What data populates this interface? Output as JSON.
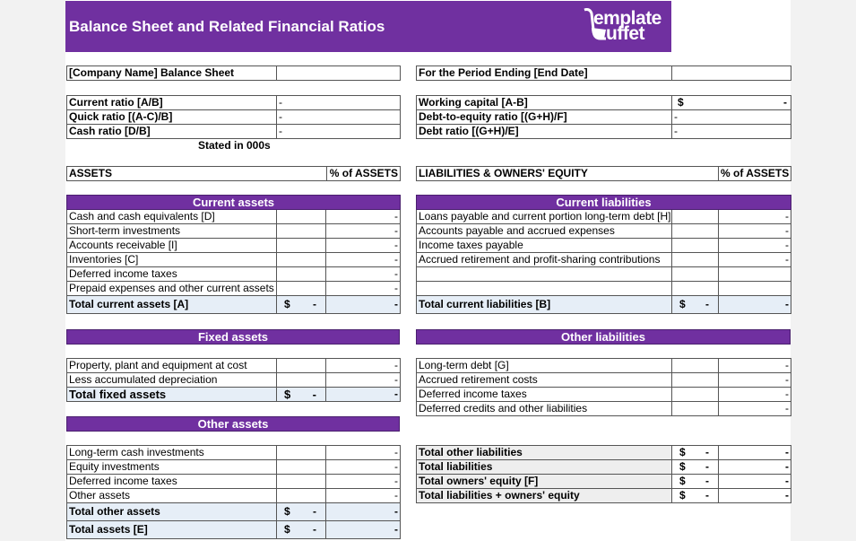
{
  "title": "Balance Sheet and Related Financial Ratios",
  "logo": {
    "line1": "emplate",
    "line2": "uffet",
    "icon": "ladle-icon"
  },
  "colors": {
    "accent": "#7030a0",
    "total_fill": "#e6eef7"
  },
  "header": {
    "company": "[Company Name] Balance Sheet",
    "company_value": "",
    "period": "For the Period Ending [End Date]",
    "period_value": ""
  },
  "ratios_left": [
    {
      "label": "Current ratio  [A/B]",
      "value": "-"
    },
    {
      "label": "Quick ratio  [(A-C)/B]",
      "value": "-"
    },
    {
      "label": "Cash ratio  [D/B]",
      "value": "-"
    }
  ],
  "ratios_right": [
    {
      "label": "Working capital  [A-B]",
      "currency": "$",
      "value": "-"
    },
    {
      "label": "Debt-to-equity ratio  [(G+H)/F]",
      "value": "-"
    },
    {
      "label": "Debt ratio  [(G+H)/E]",
      "value": "-"
    }
  ],
  "stated_note": "Stated in 000s",
  "assets": {
    "heading": "ASSETS",
    "pct_heading": "% of ASSETS",
    "current": {
      "title": "Current assets",
      "rows": [
        {
          "label": "Cash and cash equivalents  [D]",
          "amount": "",
          "pct": "-"
        },
        {
          "label": "Short-term investments",
          "amount": "",
          "pct": "-"
        },
        {
          "label": "Accounts receivable  [I]",
          "amount": "",
          "pct": "-"
        },
        {
          "label": "Inventories  [C]",
          "amount": "",
          "pct": "-"
        },
        {
          "label": "Deferred income taxes",
          "amount": "",
          "pct": "-"
        },
        {
          "label": "Prepaid expenses and other current assets",
          "amount": "",
          "pct": "-"
        }
      ],
      "total": {
        "label": "Total current assets  [A]",
        "currency": "$",
        "amount": "-",
        "pct": "-"
      }
    },
    "fixed": {
      "title": "Fixed assets",
      "rows": [
        {
          "label": "Property, plant and equipment at cost",
          "amount": "",
          "pct": "-"
        },
        {
          "label": "Less accumulated depreciation",
          "amount": "",
          "pct": "-"
        }
      ],
      "total": {
        "label": "Total fixed assets",
        "currency": "$",
        "amount": "-",
        "pct": "-"
      }
    },
    "other": {
      "title": "Other assets",
      "rows": [
        {
          "label": "Long-term cash investments",
          "amount": "",
          "pct": "-"
        },
        {
          "label": "Equity investments",
          "amount": "",
          "pct": "-"
        },
        {
          "label": "Deferred income taxes",
          "amount": "",
          "pct": "-"
        },
        {
          "label": "Other assets",
          "amount": "",
          "pct": "-"
        }
      ],
      "total": {
        "label": "Total other assets",
        "currency": "$",
        "amount": "-",
        "pct": "-"
      },
      "grand_total": {
        "label": "Total assets  [E]",
        "currency": "$",
        "amount": "-",
        "pct": "-"
      }
    }
  },
  "liabilities": {
    "heading": "LIABILITIES & OWNERS' EQUITY",
    "pct_heading": "% of ASSETS",
    "current": {
      "title": "Current liabilities",
      "rows": [
        {
          "label": "Loans payable and current portion long-term debt  [H]",
          "amount": "",
          "pct": "-"
        },
        {
          "label": "Accounts payable and accrued expenses",
          "amount": "",
          "pct": "-"
        },
        {
          "label": "Income taxes payable",
          "amount": "",
          "pct": "-"
        },
        {
          "label": "Accrued retirement and profit-sharing contributions",
          "amount": "",
          "pct": "-"
        },
        {
          "label": "",
          "amount": "",
          "pct": ""
        },
        {
          "label": "",
          "amount": "",
          "pct": ""
        }
      ],
      "total": {
        "label": "Total current liabilities  [B]",
        "currency": "$",
        "amount": "-",
        "pct": "-"
      }
    },
    "other": {
      "title": "Other liabilities",
      "rows": [
        {
          "label": "Long-term debt  [G]",
          "amount": "",
          "pct": "-"
        },
        {
          "label": "Accrued retirement costs",
          "amount": "",
          "pct": "-"
        },
        {
          "label": "Deferred income taxes",
          "amount": "",
          "pct": "-"
        },
        {
          "label": "Deferred credits and other liabilities",
          "amount": "",
          "pct": "-"
        }
      ]
    },
    "totals": [
      {
        "label": "Total other liabilities",
        "currency": "$",
        "amount": "-",
        "pct": "-"
      },
      {
        "label": "Total liabilities",
        "currency": "$",
        "amount": "-",
        "pct": "-"
      },
      {
        "label": "Total owners' equity  [F]",
        "currency": "$",
        "amount": "-",
        "pct": "-"
      },
      {
        "label": "Total liabilities + owners' equity",
        "currency": "$",
        "amount": "-",
        "pct": "-"
      }
    ]
  }
}
